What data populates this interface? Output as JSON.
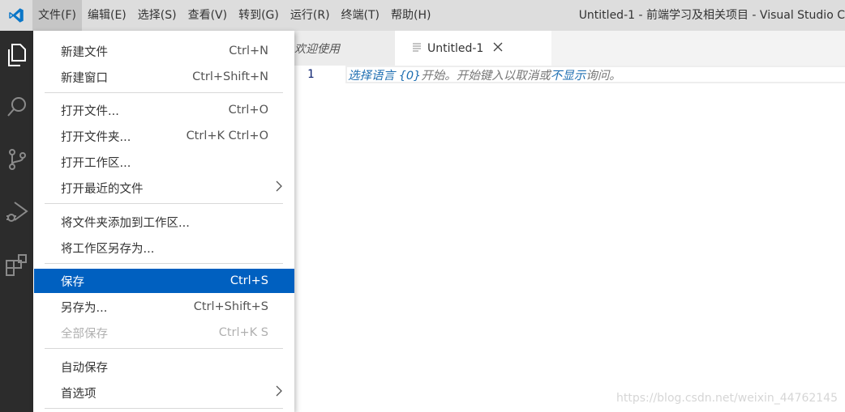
{
  "menubar": {
    "items": [
      "文件(F)",
      "编辑(E)",
      "选择(S)",
      "查看(V)",
      "转到(G)",
      "运行(R)",
      "终端(T)",
      "帮助(H)"
    ],
    "window_title": "Untitled-1 - 前端学习及相关项目 - Visual Studio C"
  },
  "tabs": [
    {
      "label": "欢迎使用"
    },
    {
      "label": "Untitled-1"
    }
  ],
  "editor": {
    "line_number": "1",
    "hint_part1": "选择语言 {0}",
    "hint_part2": "开始。开始键入以取消或",
    "hint_part3": "不显示",
    "hint_part4": "询问。"
  },
  "watermark": "https://blog.csdn.net/weixin_44762145",
  "file_menu": {
    "items": [
      {
        "label": "新建文件",
        "shortcut": "Ctrl+N"
      },
      {
        "label": "新建窗口",
        "shortcut": "Ctrl+Shift+N"
      },
      {
        "label": "打开文件...",
        "shortcut": "Ctrl+O"
      },
      {
        "label": "打开文件夹...",
        "shortcut": "Ctrl+K Ctrl+O"
      },
      {
        "label": "打开工作区...",
        "shortcut": ""
      },
      {
        "label": "打开最近的文件",
        "shortcut": ""
      },
      {
        "label": "将文件夹添加到工作区...",
        "shortcut": ""
      },
      {
        "label": "将工作区另存为...",
        "shortcut": ""
      },
      {
        "label": "保存",
        "shortcut": "Ctrl+S"
      },
      {
        "label": "另存为...",
        "shortcut": "Ctrl+Shift+S"
      },
      {
        "label": "全部保存",
        "shortcut": "Ctrl+K S"
      },
      {
        "label": "自动保存",
        "shortcut": ""
      },
      {
        "label": "首选项",
        "shortcut": ""
      }
    ],
    "highlighted_color": "#0060c0"
  },
  "icons": {
    "logo": "vscode-logo-icon",
    "activity": [
      "explorer-icon",
      "search-icon",
      "source-control-icon",
      "run-debug-icon",
      "extensions-icon"
    ],
    "tab_file": "file-text-icon",
    "tab_close": "close-icon",
    "submenu": "chevron-right-icon"
  }
}
